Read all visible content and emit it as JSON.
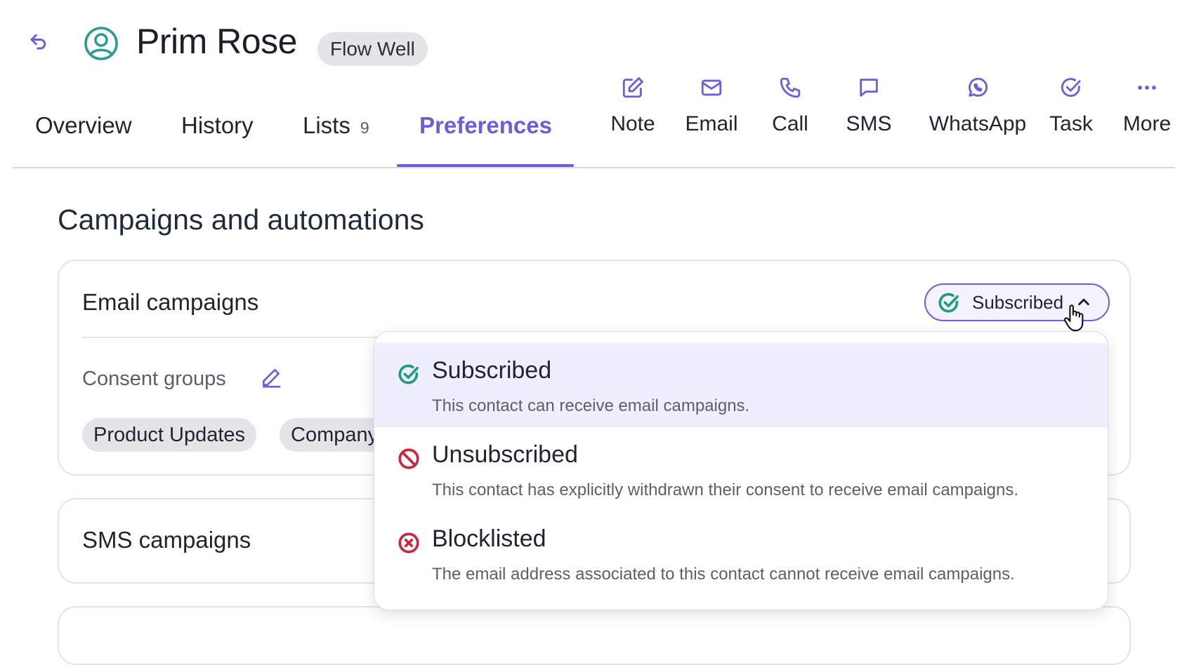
{
  "contact": {
    "name": "Prim Rose",
    "company": "Flow Well"
  },
  "tabs": [
    {
      "label": "Overview"
    },
    {
      "label": "History"
    },
    {
      "label": "Lists",
      "count": "9"
    },
    {
      "label": "Preferences",
      "active": true
    }
  ],
  "actions": [
    {
      "label": "Note",
      "icon": "edit-icon"
    },
    {
      "label": "Email",
      "icon": "mail-icon"
    },
    {
      "label": "Call",
      "icon": "phone-icon"
    },
    {
      "label": "SMS",
      "icon": "chat-icon"
    },
    {
      "label": "WhatsApp",
      "icon": "whatsapp-icon"
    },
    {
      "label": "Task",
      "icon": "check-circle-icon"
    },
    {
      "label": "More",
      "icon": "more-icon"
    }
  ],
  "section": {
    "title": "Campaigns and automations"
  },
  "email_campaigns": {
    "title": "Email campaigns",
    "status": "Subscribed",
    "consent_label": "Consent groups",
    "consent_groups": [
      "Product Updates",
      "Company"
    ]
  },
  "sms_campaigns": {
    "title": "SMS campaigns"
  },
  "dropdown": {
    "options": [
      {
        "title": "Subscribed",
        "description": "This contact can receive email campaigns.",
        "selected": true,
        "icon": "check-circle-icon"
      },
      {
        "title": "Unsubscribed",
        "description": "This contact has explicitly withdrawn their consent to receive email campaigns.",
        "icon": "ban-icon"
      },
      {
        "title": "Blocklisted",
        "description": "The email address associated to this contact cannot receive email campaigns.",
        "icon": "x-circle-icon"
      }
    ]
  },
  "colors": {
    "accent": "#6a5fd8",
    "success": "#1f9d7a",
    "danger": "#c8283f",
    "avatar": "#2a9d8f"
  }
}
